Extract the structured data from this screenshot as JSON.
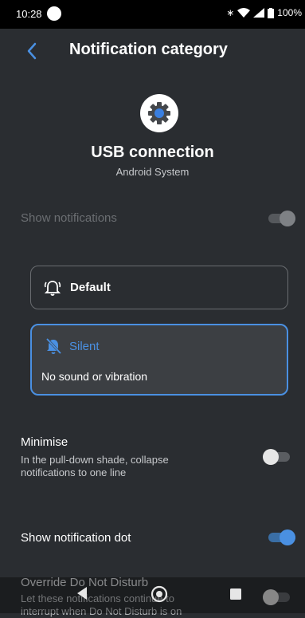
{
  "status_bar": {
    "time": "10:28",
    "battery": "100%"
  },
  "header": {
    "title": "Notification category"
  },
  "app": {
    "name": "USB connection",
    "source": "Android System"
  },
  "show_notifications": {
    "label": "Show notifications",
    "enabled": true
  },
  "behaviour_options": [
    {
      "label": "Default",
      "selected": false
    },
    {
      "label": "Silent",
      "description": "No sound or vibration",
      "selected": true
    }
  ],
  "minimise": {
    "title": "Minimise",
    "subtitle_line1": "In the pull-down shade, collapse",
    "subtitle_line2": "notifications to one line",
    "enabled": false
  },
  "notification_dot": {
    "title": "Show notification dot",
    "enabled": true
  },
  "override_dnd": {
    "title": "Override Do Not Disturb",
    "subtitle_line1": "Let these notifications continue to",
    "subtitle_line2": "interrupt when Do Not Disturb is on",
    "enabled": false
  },
  "colors": {
    "accent": "#4a90e2",
    "background": "#2a2d31"
  }
}
